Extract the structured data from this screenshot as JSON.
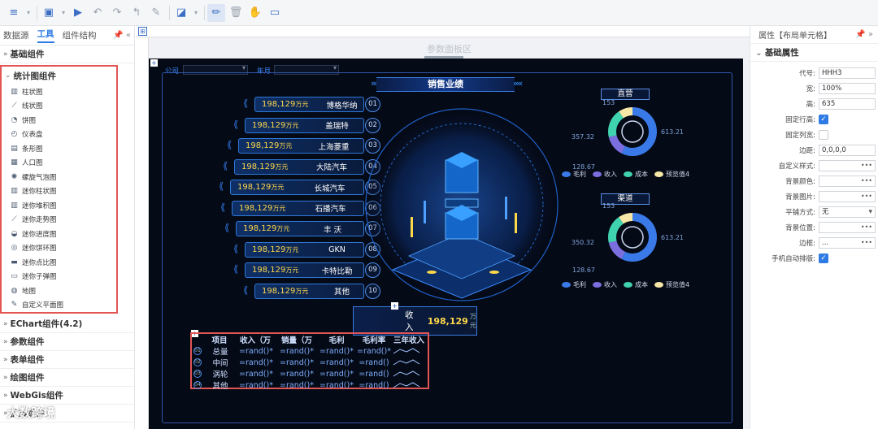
{
  "left": {
    "tabs": [
      "数据源",
      "工具",
      "组件结构"
    ],
    "groups_top": [
      "基础组件"
    ],
    "chart_group": "统计图组件",
    "chart_items": [
      "柱状图",
      "线状图",
      "饼图",
      "仪表盘",
      "条形图",
      "人口图",
      "螺旋气泡图",
      "迷你柱状图",
      "迷你堆积图",
      "迷你走势图",
      "迷你进度图",
      "迷你饼环图",
      "迷你点比图",
      "迷你子弹图",
      "地图",
      "自定义平面图"
    ],
    "groups_bottom": [
      "EChart组件(4.2)",
      "参数组件",
      "表单组件",
      "绘图组件",
      "WebGis组件",
      "扩展组件"
    ]
  },
  "mid": {
    "param_area": "参数面板区",
    "ctl_company": "公司",
    "ctl_month": "年月"
  },
  "dash": {
    "title": "销售业绩",
    "ranks": [
      {
        "value": "198,129",
        "unit": "万元",
        "name": "博格华纳",
        "idx": "01"
      },
      {
        "value": "198,129",
        "unit": "万元",
        "name": "盖瑞特",
        "idx": "02"
      },
      {
        "value": "198,129",
        "unit": "万元",
        "name": "上海菱重",
        "idx": "03"
      },
      {
        "value": "198,129",
        "unit": "万元",
        "name": "大陆汽车",
        "idx": "04"
      },
      {
        "value": "198,129",
        "unit": "万元",
        "name": "长城汽车",
        "idx": "05"
      },
      {
        "value": "198,129",
        "unit": "万元",
        "name": "石播汽车",
        "idx": "06"
      },
      {
        "value": "198,129",
        "unit": "万元",
        "name": "丰 沃",
        "idx": "07"
      },
      {
        "value": "198,129",
        "unit": "万元",
        "name": "GKN",
        "idx": "08"
      },
      {
        "value": "198,129",
        "unit": "万元",
        "name": "卡特比勒",
        "idx": "09"
      },
      {
        "value": "198,129",
        "unit": "万元",
        "name": "其他",
        "idx": "10"
      }
    ],
    "income_label": "收入",
    "income_value": "198,129",
    "income_unit": "万元",
    "donut1": {
      "title": "直营",
      "top": "153",
      "left": "357.32",
      "right": "613.21",
      "bottom": "128.67"
    },
    "donut2": {
      "title": "渠道",
      "top": "153",
      "left": "350.32",
      "right": "613.21",
      "bottom": "128.67"
    },
    "legend": [
      "毛利",
      "收入",
      "成本",
      "预览值4"
    ],
    "legend_colors": [
      "#3a7ae8",
      "#7b6fe0",
      "#3fd3b0",
      "#f6e7a6"
    ],
    "table": {
      "headers": [
        "项目",
        "收入（万",
        "销量（万",
        "毛利",
        "毛利率",
        "三年收入"
      ],
      "rows": [
        {
          "idx": "01",
          "name": "总量",
          "c1": "=rand()*",
          "c2": "=rand()*",
          "c3": "=rand()*",
          "c4": "=rand()*"
        },
        {
          "idx": "02",
          "name": "中间",
          "c1": "=rand()*",
          "c2": "=rand()*",
          "c3": "=rand()*",
          "c4": "=rand()"
        },
        {
          "idx": "03",
          "name": "涡轮",
          "c1": "=rand()*",
          "c2": "=rand()*",
          "c3": "=rand()*",
          "c4": "=rand()"
        },
        {
          "idx": "04",
          "name": "其他",
          "c1": "=rand()*",
          "c2": "=rand()*",
          "c3": "=rand()*",
          "c4": "=rand()"
        }
      ]
    }
  },
  "right": {
    "title": "属性【布局单元格】",
    "group": "基础属性",
    "props": [
      {
        "label": "代号:",
        "value": "HHH3",
        "type": "input"
      },
      {
        "label": "宽:",
        "value": "100%",
        "type": "input"
      },
      {
        "label": "高:",
        "value": "635",
        "type": "input"
      },
      {
        "label": "固定行高:",
        "value": "",
        "type": "check-on"
      },
      {
        "label": "固定列宽:",
        "value": "",
        "type": "check-off"
      },
      {
        "label": "边距:",
        "value": "0,0,0,0",
        "type": "input"
      },
      {
        "label": "自定义样式:",
        "value": "",
        "type": "more"
      },
      {
        "label": "背景颜色:",
        "value": "",
        "type": "more"
      },
      {
        "label": "背景图片:",
        "value": "",
        "type": "more"
      },
      {
        "label": "平铺方式:",
        "value": "无",
        "type": "select"
      },
      {
        "label": "背景位置:",
        "value": "",
        "type": "more"
      },
      {
        "label": "边框:",
        "value": "...",
        "type": "more"
      },
      {
        "label": "手机自动排版:",
        "value": "",
        "type": "check-on"
      }
    ]
  },
  "watermark": "大数跨境"
}
